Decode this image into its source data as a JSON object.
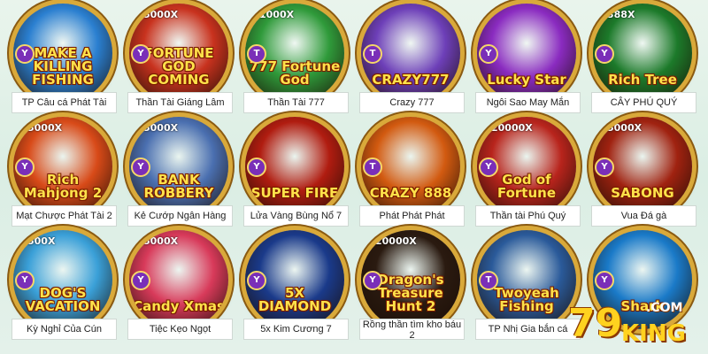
{
  "games": [
    {
      "caption": "TP Câu cá Phát Tài",
      "title": "MAKE A KILLING FISHING",
      "badge": "Y",
      "multiplier": "",
      "bg": "#2a7fd0",
      "ring": "#f0b830"
    },
    {
      "caption": "Thần Tài Giáng Lâm",
      "title": "FORTUNE GOD COMING",
      "badge": "Y",
      "multiplier": "5000X",
      "bg": "#c8321e",
      "ring": "#f0b830"
    },
    {
      "caption": "Thần Tài 777",
      "title": "777 Fortune God",
      "badge": "T",
      "multiplier": "1000X",
      "bg": "#2f9a3a",
      "ring": "#f0b830"
    },
    {
      "caption": "Crazy 777",
      "title": "CRAZY777",
      "badge": "T",
      "multiplier": "",
      "bg": "#6d3fb8",
      "ring": "#f0b830"
    },
    {
      "caption": "Ngôi Sao May Mắn",
      "title": "Lucky Star",
      "badge": "Y",
      "multiplier": "",
      "bg": "#8a2bc0",
      "ring": "#f0b830"
    },
    {
      "caption": "CÂY PHÚ QUÝ",
      "title": "Rich Tree",
      "badge": "Y",
      "multiplier": "388X",
      "bg": "#1c7a2a",
      "ring": "#f0b830"
    },
    {
      "caption": "Mạt Chược Phát Tài 2",
      "title": "Rich Mahjong 2",
      "badge": "Y",
      "multiplier": "5000X",
      "bg": "#d84a18",
      "ring": "#f0b830"
    },
    {
      "caption": "Kẻ Cướp Ngân Hàng",
      "title": "BANK ROBBERY",
      "badge": "Y",
      "multiplier": "5000X",
      "bg": "#4a6fb0",
      "ring": "#f0b830"
    },
    {
      "caption": "Lửa Vàng Bùng Nổ 7",
      "title": "SUPER FIRE",
      "badge": "Y",
      "multiplier": "",
      "bg": "#b01c10",
      "ring": "#f0b830"
    },
    {
      "caption": "Phát Phát Phát",
      "title": "CRAZY 888",
      "badge": "T",
      "multiplier": "",
      "bg": "#d25a10",
      "ring": "#f0b830"
    },
    {
      "caption": "Thần tài Phú Quý",
      "title": "God of Fortune",
      "badge": "Y",
      "multiplier": "20000X",
      "bg": "#b8241c",
      "ring": "#f0b830"
    },
    {
      "caption": "Vua Đá gà",
      "title": "SABONG",
      "badge": "Y",
      "multiplier": "5000X",
      "bg": "#a02210",
      "ring": "#f0b830"
    },
    {
      "caption": "Kỳ Nghỉ Của Cún",
      "title": "DOG'S VACATION",
      "badge": "Y",
      "multiplier": "500X",
      "bg": "#3aa0d8",
      "ring": "#f0b830"
    },
    {
      "caption": "Tiệc Kẹo Ngọt",
      "title": "Candy Xmas",
      "badge": "Y",
      "multiplier": "5000X",
      "bg": "#d83a5a",
      "ring": "#f0b830"
    },
    {
      "caption": "5x Kim Cương 7",
      "title": "5X DIAMOND",
      "badge": "Y",
      "multiplier": "",
      "bg": "#1a3a8a",
      "ring": "#f0b830"
    },
    {
      "caption": "Rồng thần tìm kho báu 2",
      "title": "Dragon's Treasure Hunt 2",
      "badge": "Y",
      "multiplier": "20000X",
      "bg": "#2a1a10",
      "ring": "#f0b830"
    },
    {
      "caption": "TP Nhị Gia bắn cá",
      "title": "Twoyeah Fishing",
      "badge": "T",
      "multiplier": "",
      "bg": "#2a5a9a",
      "ring": "#f0b830"
    },
    {
      "caption": "",
      "title": "Shark",
      "badge": "Y",
      "multiplier": "",
      "bg": "#1a7ac8",
      "ring": "#f0b830"
    }
  ],
  "logo": {
    "number": "79",
    "word": "KING",
    "suffix": ".COM"
  }
}
